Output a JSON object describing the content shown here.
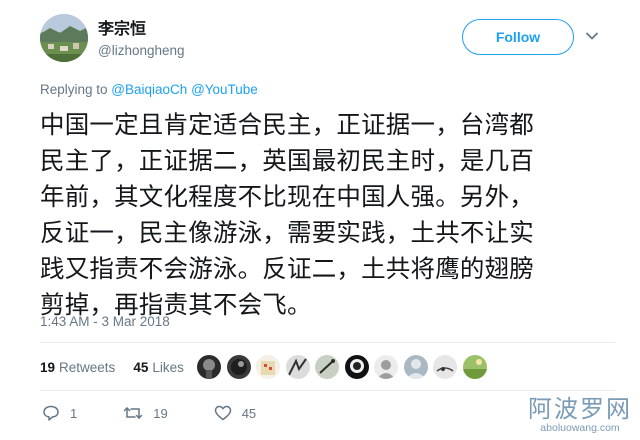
{
  "user": {
    "display_name": "李宗恒",
    "handle": "@lizhongheng",
    "follow_label": "Follow"
  },
  "reply": {
    "prefix": "Replying to ",
    "mentions": [
      "@BaiqiaoCh",
      "@YouTube"
    ]
  },
  "tweet": {
    "lines": [
      "中国一定且肯定适合民主，正证据一，台湾都",
      "民主了，正证据二，英国最初民主时，是几百",
      "年前，其文化程度不比现在中国人强。另外，",
      "反证一，民主像游泳，需要实践，土共不让实",
      "践又指责不会游泳。反证二，土共将鹰的翅膀",
      "剪掉，再指责其不会飞。"
    ],
    "timestamp": "1:43 AM - 3 Mar 2018"
  },
  "stats": {
    "retweets_count": "19",
    "retweets_label": "Retweets",
    "likes_count": "45",
    "likes_label": "Likes"
  },
  "actions": {
    "replies": "1",
    "retweets": "19",
    "likes": "45"
  },
  "colors": {
    "accent": "#1da1f2",
    "muted": "#657786",
    "text": "#14171a"
  },
  "watermark": {
    "title": "阿波罗网",
    "url": "aboluowang.com"
  }
}
